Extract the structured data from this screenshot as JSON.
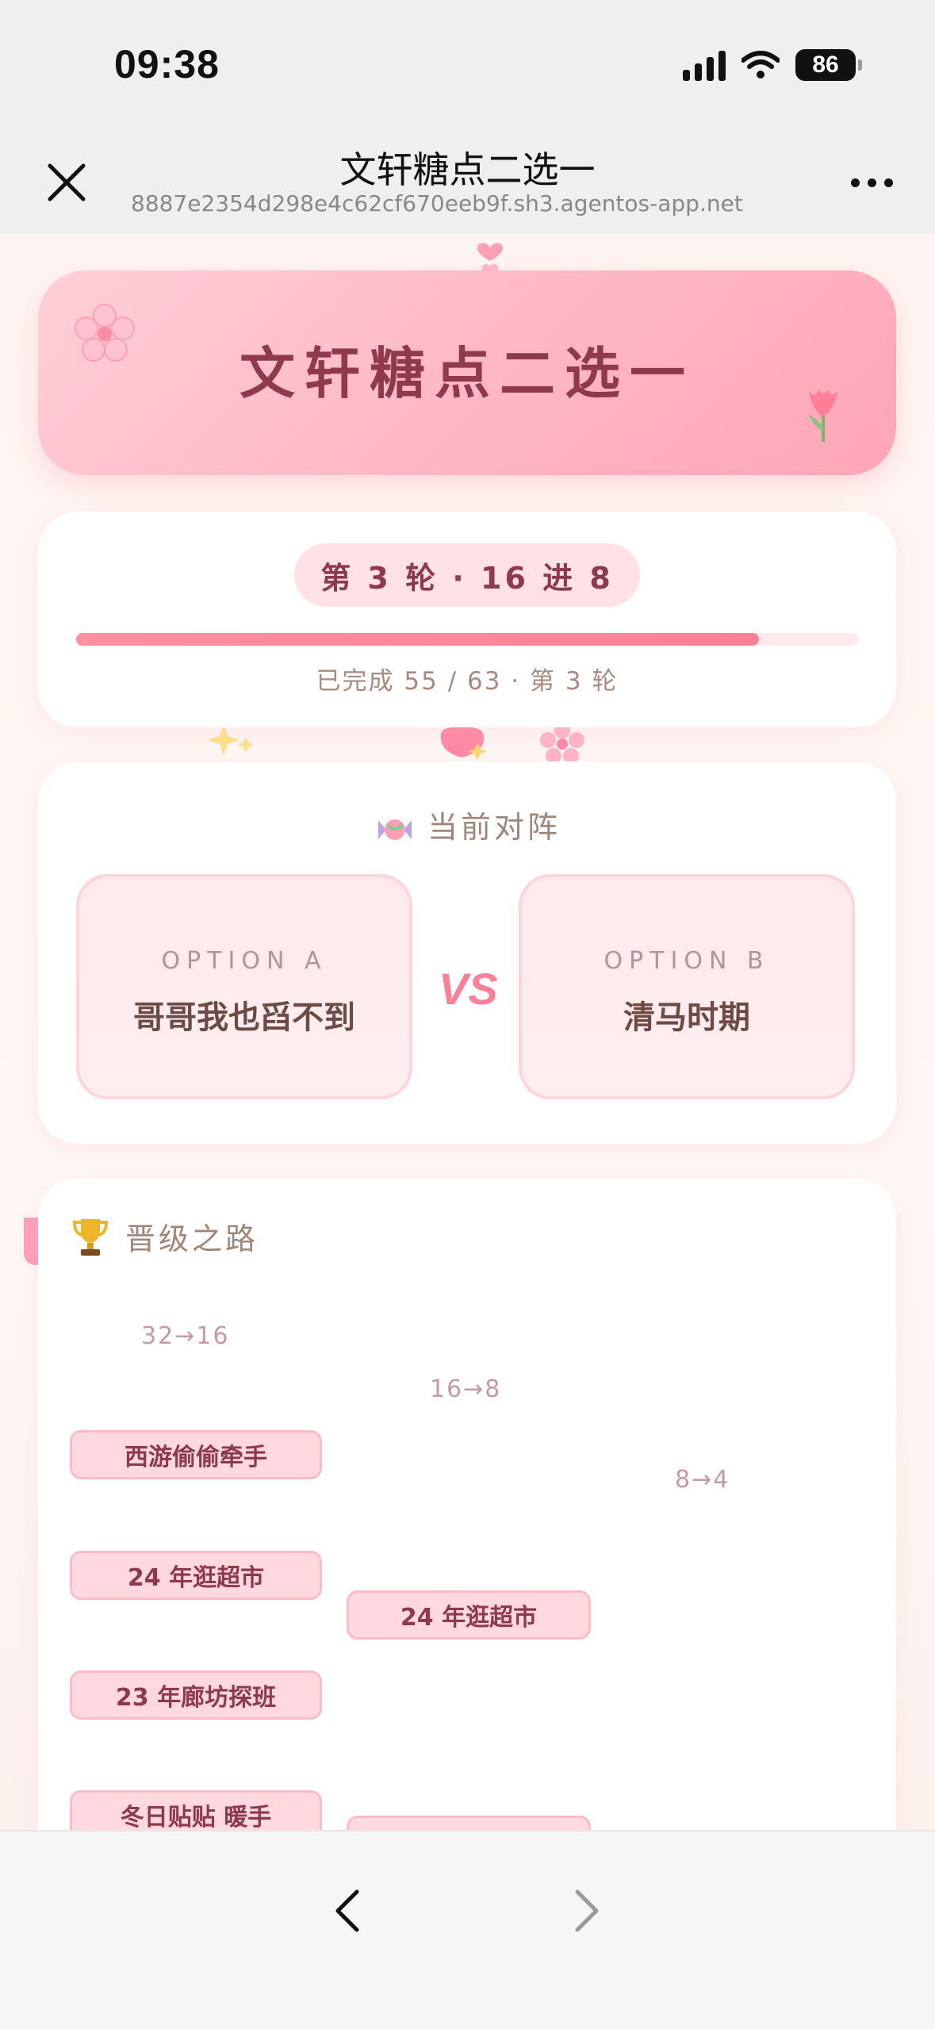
{
  "status_bar": {
    "time": "09:38",
    "battery": "86"
  },
  "nav": {
    "title": "文轩糖点二选一",
    "url": "8887e2354d298e4c62cf670eeb9f.sh3.agentos-app.net"
  },
  "hero": {
    "title": "文轩糖点二选一"
  },
  "progress": {
    "round_label": "第 3 轮 · 16 进 8",
    "completed": 55,
    "total": 63,
    "text": "已完成 55 / 63 · 第 3 轮"
  },
  "matchup": {
    "heading": "当前对阵",
    "option_a": {
      "label": "OPTION A",
      "name": "哥哥我也舀不到"
    },
    "vs": "VS",
    "option_b": {
      "label": "OPTION B",
      "name": "清马时期"
    }
  },
  "bracket": {
    "heading": "晋级之路",
    "columns": [
      "32→16",
      "16→8",
      "8→4"
    ],
    "round1": [
      "西游偷偷牵手",
      "24 年逛超市",
      "23 年廊坊探班",
      "冬日贴贴 暖手"
    ],
    "round2": [
      "24 年逛超市",
      ""
    ]
  },
  "colors": {
    "accent": "#ff7f96",
    "hero_text": "#8e3a4c",
    "muted_text": "#a08678"
  }
}
